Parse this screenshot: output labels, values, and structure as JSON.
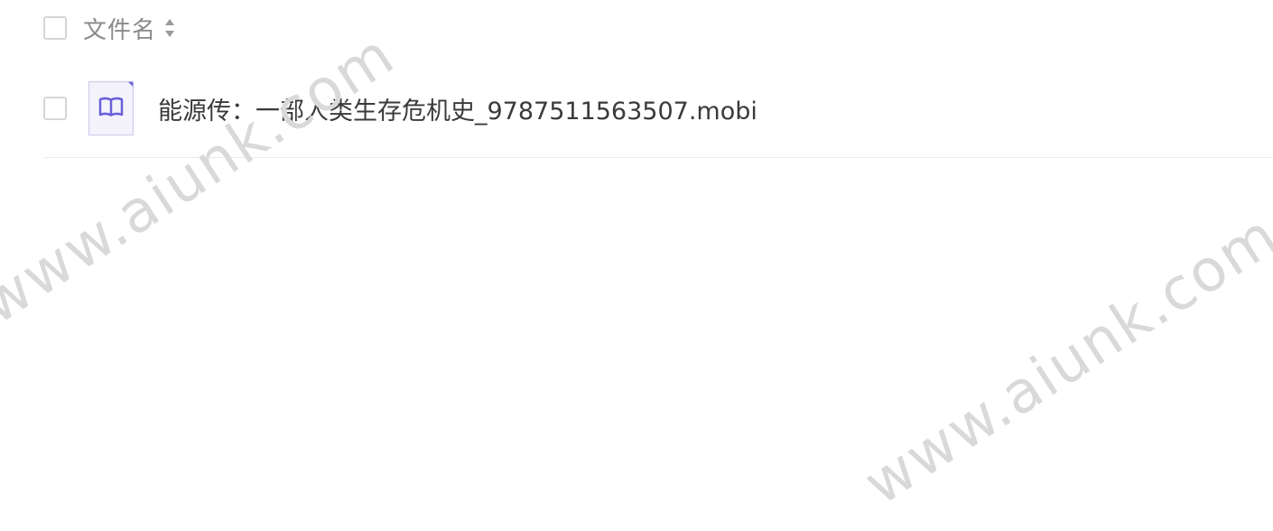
{
  "header": {
    "column_label": "文件名",
    "select_all_checked": false,
    "sort_icon": "sort-icon"
  },
  "files": [
    {
      "name": "能源传：一部人类生存危机史_9787511563507.mobi",
      "icon": "book-icon",
      "checked": false
    }
  ],
  "watermarks": [
    {
      "text": "www.aiunk.com"
    },
    {
      "text": "www.aiunk.com"
    }
  ],
  "colors": {
    "icon_accent": "#6a5fd8",
    "icon_bg": "#f4f3fc",
    "text_primary": "#3a3a3a",
    "text_secondary": "#8a8a8a"
  }
}
